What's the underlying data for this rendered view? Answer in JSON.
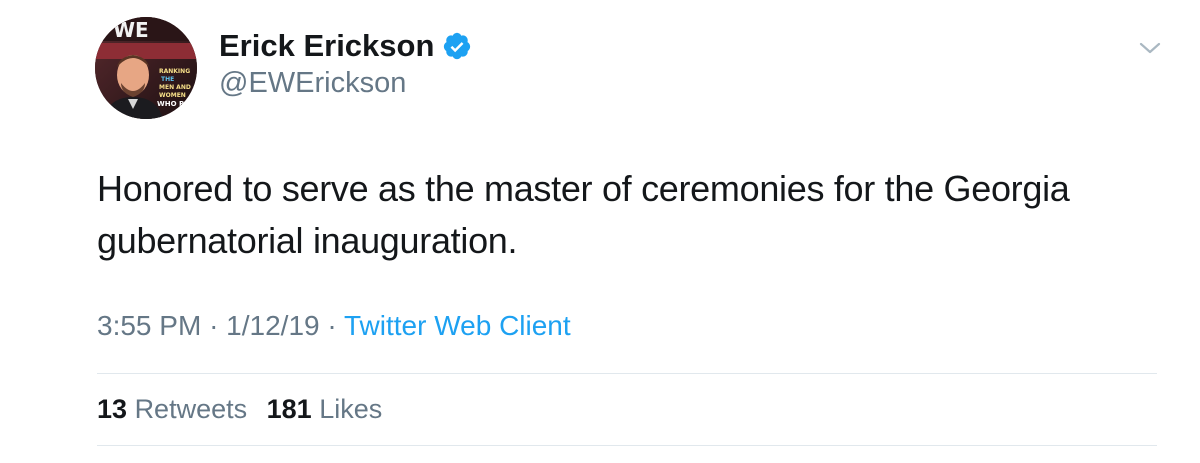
{
  "author": {
    "name": "Erick Erickson",
    "handle": "@EWErickson",
    "verified": true,
    "avatar_icon": "profile-photo"
  },
  "tweet": {
    "text": "Honored to serve as the master of ceremonies for the Georgia gubernatorial inauguration.",
    "time": "3:55 PM",
    "separator": "·",
    "date": "1/12/19",
    "source": "Twitter Web Client"
  },
  "stats": {
    "retweets_count": "13",
    "retweets_label": "Retweets",
    "likes_count": "181",
    "likes_label": "Likes"
  },
  "colors": {
    "accent": "#1da1f2",
    "secondary_text": "#657786",
    "primary_text": "#14171a",
    "divider": "#e1e8ed"
  },
  "icons": {
    "verified": "verified-badge-icon",
    "menu": "chevron-down-icon"
  }
}
